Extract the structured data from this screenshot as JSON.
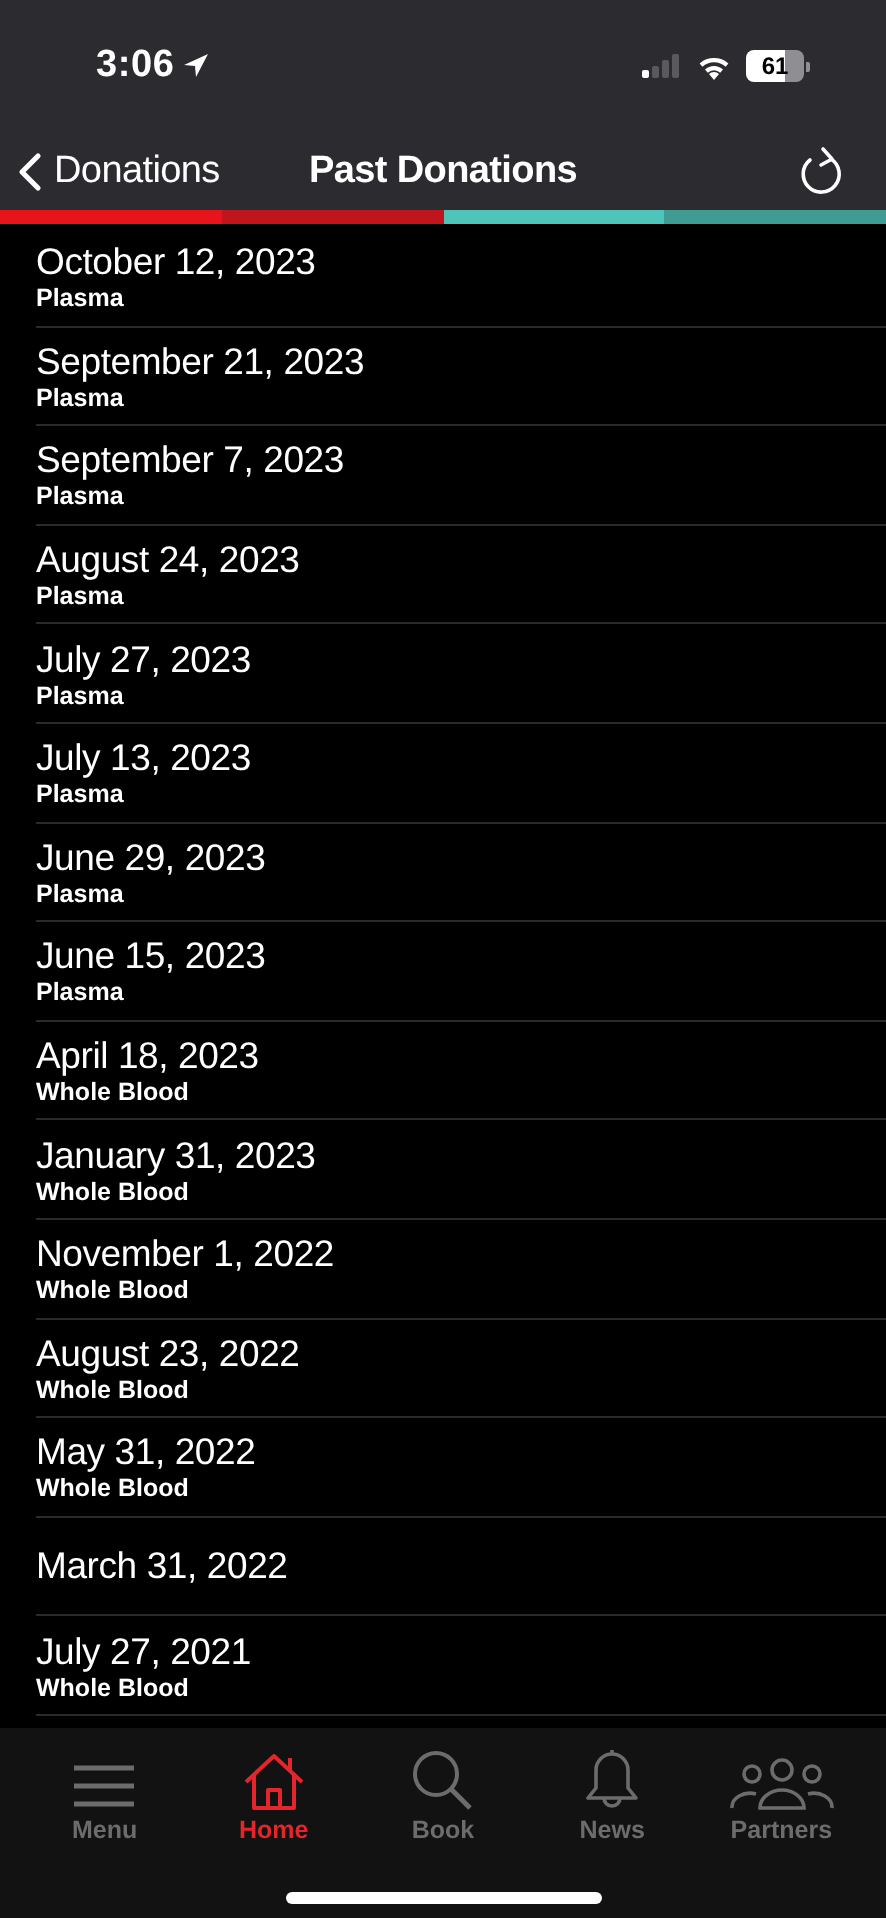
{
  "status_bar": {
    "time": "3:06",
    "battery": "61"
  },
  "nav_bar": {
    "back_label": "Donations",
    "title": "Past Donations"
  },
  "donations": [
    {
      "date": "October 12, 2023",
      "type": "Plasma"
    },
    {
      "date": "September 21, 2023",
      "type": "Plasma"
    },
    {
      "date": "September 7, 2023",
      "type": "Plasma"
    },
    {
      "date": "August 24, 2023",
      "type": "Plasma"
    },
    {
      "date": "July 27, 2023",
      "type": "Plasma"
    },
    {
      "date": "July 13, 2023",
      "type": "Plasma"
    },
    {
      "date": "June 29, 2023",
      "type": "Plasma"
    },
    {
      "date": "June 15, 2023",
      "type": "Plasma"
    },
    {
      "date": "April 18, 2023",
      "type": "Whole Blood"
    },
    {
      "date": "January 31, 2023",
      "type": "Whole Blood"
    },
    {
      "date": "November 1, 2022",
      "type": "Whole Blood"
    },
    {
      "date": "August 23, 2022",
      "type": "Whole Blood"
    },
    {
      "date": "May 31, 2022",
      "type": "Whole Blood"
    },
    {
      "date": "March 31, 2022"
    },
    {
      "date": "July 27, 2021",
      "type": "Whole Blood"
    }
  ],
  "tab_bar": [
    {
      "kind": "menu",
      "label": "Menu",
      "selected": false
    },
    {
      "kind": "home",
      "label": "Home",
      "selected": true
    },
    {
      "kind": "book",
      "label": "Book",
      "selected": false
    },
    {
      "kind": "news",
      "label": "News",
      "selected": false
    },
    {
      "kind": "partners",
      "label": "Partners",
      "selected": false
    }
  ]
}
